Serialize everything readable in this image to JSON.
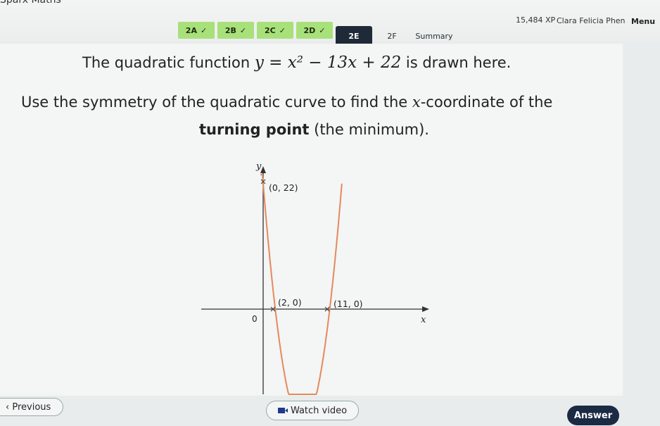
{
  "header": {
    "brand": "Sparx Maths",
    "xp": "15,484 XP",
    "user": "Clara Felicia Phen",
    "menu": "Menu"
  },
  "tabs": [
    {
      "label": "2A",
      "done": true
    },
    {
      "label": "2B",
      "done": true
    },
    {
      "label": "2C",
      "done": true
    },
    {
      "label": "2D",
      "done": true
    },
    {
      "label": "2E",
      "done": false,
      "active": true
    },
    {
      "label": "2F",
      "done": false
    },
    {
      "label": "Summary",
      "done": false
    }
  ],
  "question": {
    "line1_pre": "The quadratic function",
    "equation": "y = x² − 13x + 22",
    "line1_post": "is drawn here.",
    "line2_pre": "Use the symmetry of the quadratic curve to find the",
    "line2_var": "x",
    "line2_post": "-coordinate of the",
    "line3_bold": "turning point",
    "line3_post": "(the minimum)."
  },
  "graph": {
    "y_axis_label": "y",
    "x_axis_label": "x",
    "origin_label": "0",
    "point_intercept_y": "(0, 22)",
    "point_root_1": "(2, 0)",
    "point_root_2": "(11, 0)",
    "curve_color": "#e38a5c"
  },
  "footer": {
    "previous": "Previous",
    "watch_video": "Watch video",
    "answer": "Answer"
  },
  "icons": {
    "previous": "chevron-left-icon",
    "watch": "video-camera-icon",
    "check": "check-icon"
  }
}
